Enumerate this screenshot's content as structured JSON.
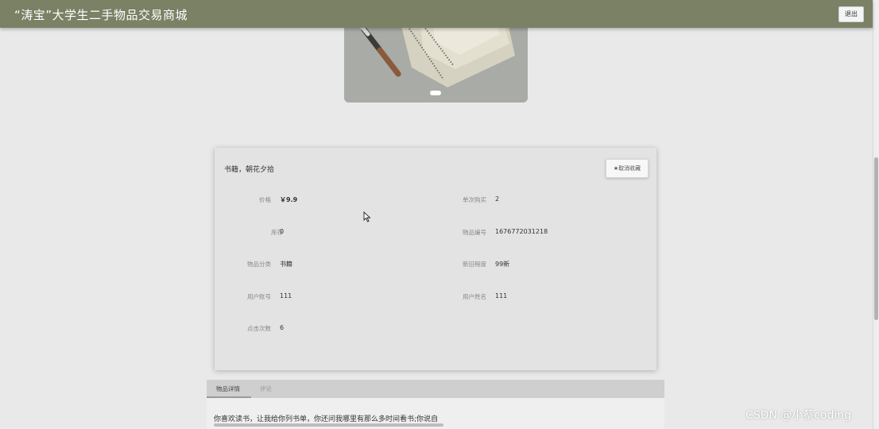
{
  "header": {
    "title": "“涛宝”大学生二手物品交易商城",
    "logout_label": "退出"
  },
  "product": {
    "name": "书籍，朝花夕拾",
    "favorite_label": "★取消收藏",
    "fields": {
      "price": {
        "label": "价格",
        "value": "￥9.9"
      },
      "max_buy": {
        "label": "单次购买",
        "value": "2"
      },
      "stock": {
        "label": "库存",
        "value": "0"
      },
      "item_no": {
        "label": "物品编号",
        "value": "1676772031218"
      },
      "category": {
        "label": "物品分类",
        "value": "书籍"
      },
      "condition": {
        "label": "新旧程度",
        "value": "99新"
      },
      "user_acct": {
        "label": "用户账号",
        "value": "111"
      },
      "user_name": {
        "label": "用户姓名",
        "value": "111"
      },
      "clicks": {
        "label": "点击次数",
        "value": "6"
      }
    }
  },
  "tabs": {
    "items": [
      {
        "label": "物品详情"
      },
      {
        "label": "评论"
      }
    ],
    "active_text": "你喜欢读书，让我给你列书单，你还问我哪里有那么多时间看书;你说自"
  },
  "watermark": "CSDN @小蔡coding",
  "colors": {
    "header_bg": "#7a8165",
    "page_bg": "#e9e9e9",
    "card_bg": "#e3e3e3"
  }
}
